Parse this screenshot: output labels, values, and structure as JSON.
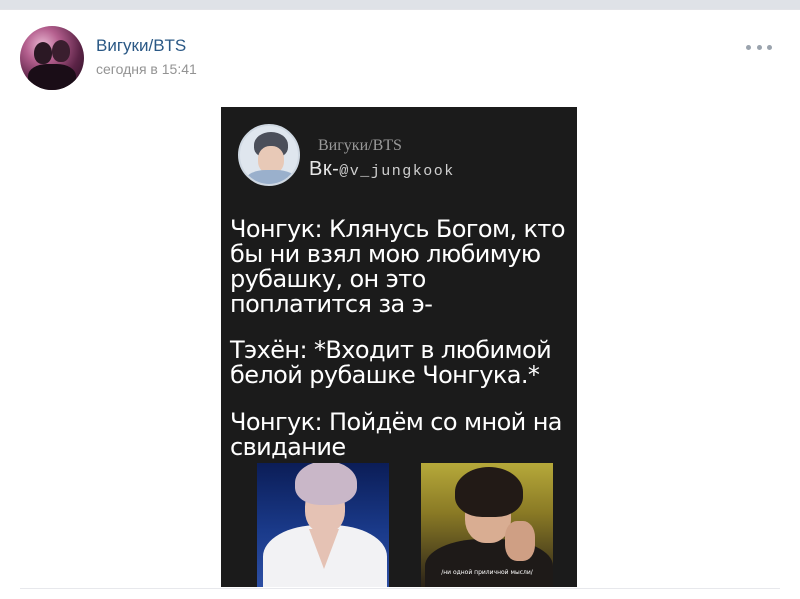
{
  "post": {
    "author": "Вигуки/BTS",
    "timestamp": "сегодня в 15:41",
    "more_icon": "more-horizontal-icon"
  },
  "image": {
    "source_name": "Вигуки/BTS",
    "source_handle_prefix": "Вк-",
    "source_handle": "@v_jungkook",
    "text_1": "Чонгук: Клянусь Богом, кто\nбы ни взял мою любимую\nрубашку, он это\nпоплатится за э-",
    "text_2": "Тэхён: *Входит в любимой\nбелой рубашке Чонгука.*",
    "text_3": "Чонгук: Пойдём со мной на\nсвидание",
    "photo_caption": "/ни одной приличной мысли/"
  },
  "colors": {
    "author_link": "#2a5885",
    "timestamp": "#939393",
    "image_background": "#1b1b1b"
  }
}
